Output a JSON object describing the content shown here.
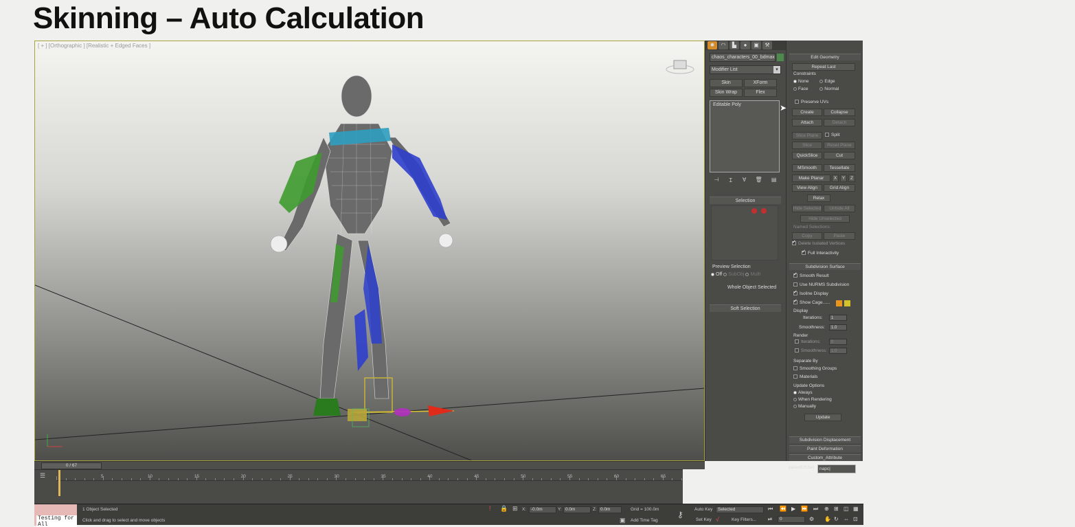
{
  "slide": {
    "title": "Skinning – Auto Calculation"
  },
  "viewport": {
    "label": "[ + ] [Orthographic ] [Realistic + Edged Faces ]"
  },
  "command_panel": {
    "tabs": [
      "create",
      "modify",
      "hierarchy",
      "motion",
      "display",
      "utilities"
    ],
    "object_name": "chaos_characters_00_bdmax",
    "modifier_list": "Modifier List",
    "modifier_buttons": [
      "Skin",
      "XForm",
      "Skin Wrap",
      "Flex"
    ],
    "stack_item": "Editable Poly",
    "selection_header": "Selection",
    "preview_selection": "Preview Selection",
    "preview_options": [
      "Off",
      "SubObj",
      "Multi"
    ],
    "whole_object": "Whole Object Selected",
    "soft_selection": "Soft Selection"
  },
  "edit_geometry": {
    "header": "Edit Geometry",
    "repeat_last": "Repeat Last",
    "constraints_label": "Constraints",
    "constraints": [
      "None",
      "Edge",
      "Face",
      "Normal"
    ],
    "preserve_uvs": "Preserve UVs",
    "create": "Create",
    "collapse": "Collapse",
    "attach": "Attach",
    "detach": "Detach",
    "slice_plane": "Slice Plane",
    "split": "Split",
    "slice": "Slice",
    "reset_plane": "Reset Plane",
    "quickslice": "QuickSlice",
    "cut": "Cut",
    "msmooth": "MSmooth",
    "tessellate": "Tessellate",
    "make_planar": "Make Planar",
    "xyz": [
      "X",
      "Y",
      "Z"
    ],
    "view_align": "View Align",
    "grid_align": "Grid Align",
    "relax": "Relax",
    "hide_selected": "Hide Selected",
    "unhide_all": "Unhide All",
    "hide_unselected": "Hide Unselected",
    "named_selections": "Named Selections:",
    "copy": "Copy",
    "paste": "Paste",
    "delete_isolated": "Delete Isolated Vertices",
    "full_interactivity": "Full Interactivity"
  },
  "subdivision_surface": {
    "header": "Subdivision Surface",
    "smooth_result": "Smooth Result",
    "use_nurms": "Use NURMS Subdivision",
    "isoline_display": "Isoline Display",
    "show_cage": "Show Cage......",
    "display_label": "Display",
    "iterations_label": "Iterations:",
    "iterations_value": "1",
    "smoothness_label": "Smoothness:",
    "smoothness_value": "1.0",
    "render_label": "Render",
    "render_iterations": "0",
    "render_smoothness": "1.0",
    "separate_by": "Separate By",
    "smoothing_groups": "Smoothing Groups",
    "materials": "Materials",
    "update_options": "Update Options",
    "always": "Always",
    "when_rendering": "When Rendering",
    "manually": "Manually",
    "update": "Update",
    "cage_colors": [
      "#e8961e",
      "#d4c22a"
    ]
  },
  "rollouts": [
    "Subdivision Displacement",
    "Paint Deformation",
    "Custom_Attribute"
  ],
  "custom_attribute": {
    "label": "parentUSSet",
    "value": "napc|"
  },
  "timeline": {
    "slider_text": "0 / 67",
    "ticks": [
      "5",
      "10",
      "15",
      "20",
      "25",
      "30",
      "35",
      "40",
      "45",
      "50",
      "55",
      "60",
      "65"
    ]
  },
  "status": {
    "maxscript": "Testing for All",
    "selected": "1 Object Selected",
    "prompt": "Click and drag to select and move objects",
    "x_label": "X:",
    "x_value": "-0.0m",
    "y_label": "Y:",
    "y_value": "0.0m",
    "z_label": "Z:",
    "z_value": "0.0m",
    "grid": "Grid = 100.0m",
    "add_time_tag": "Add Time Tag",
    "auto_key": "Auto Key",
    "set_key": "Set Key",
    "selected_dropdown": "Selected",
    "key_filters": "Key Filters...",
    "frame_value": "0"
  }
}
